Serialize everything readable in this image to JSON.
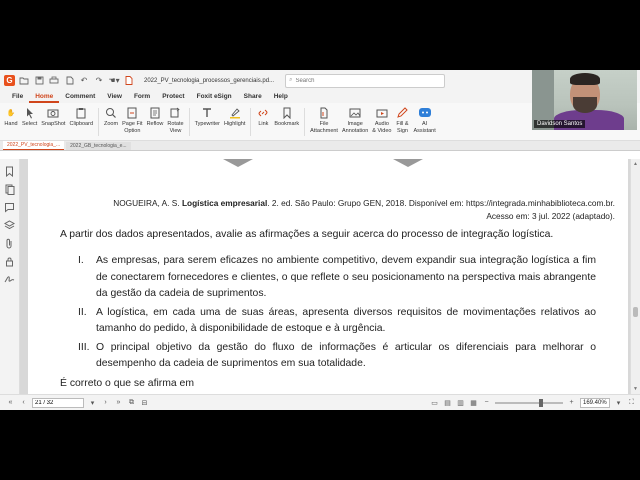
{
  "titlebar": {
    "doc_title": "2022_PV_tecnologia_processos_gerenciais.pd...",
    "search_placeholder": "Search"
  },
  "menu": {
    "items": [
      "File",
      "Home",
      "Comment",
      "View",
      "Form",
      "Protect",
      "Foxit eSign",
      "Share",
      "Help"
    ],
    "active": "Home"
  },
  "ribbon": {
    "hand": "Hand",
    "select": "Select",
    "snapshot": "SnapShot",
    "clipboard": "Clipboard",
    "zoom": "Zoom",
    "page_fit": "Page Fit\nOption",
    "reflow": "Reflow",
    "rotate": "Rotate\nView",
    "typewriter": "Typewriter",
    "highlight": "Highlight",
    "link": "Link",
    "bookmark": "Bookmark",
    "file_attachment": "File\nAttachment",
    "image_annotation": "Image\nAnnotation",
    "audio_video": "Audio\n& Video",
    "fill_sign": "Fill &\nSign",
    "ai_assistant": "AI\nAssistant"
  },
  "tabs": [
    "2022_PV_tecnologia_...",
    "2022_GB_tecnologia_e..."
  ],
  "document": {
    "ref_author": "NOGUEIRA, A. S.",
    "ref_title": "Logística empresarial",
    "ref_rest": ". 2. ed. São Paulo: Grupo GEN, 2018. Disponível em: https://integrada.minhabiblioteca.com.br.",
    "ref_access": "Acesso em: 3 jul. 2022 (adaptado).",
    "stem": "A partir dos dados apresentados, avalie as afirmações a seguir acerca do processo de integração logística.",
    "items": [
      {
        "num": "I.",
        "text": "As empresas, para serem eficazes no ambiente competitivo, devem expandir sua integração logística a fim de conectarem fornecedores e clientes, o que reflete o seu posicionamento na perspectiva mais abrangente da gestão da cadeia de suprimentos."
      },
      {
        "num": "II.",
        "text": "A logística, em cada uma de suas áreas, apresenta diversos requisitos de movimentações relativos ao tamanho do pedido, à disponibilidade de estoque e à urgência."
      },
      {
        "num": "III.",
        "text": "O principal objetivo da gestão do fluxo de informações é articular os diferenciais para melhorar o desempenho da cadeia de suprimentos em sua totalidade."
      }
    ],
    "closing": "É correto o que se afirma em"
  },
  "status": {
    "page": "21 / 32",
    "zoom": "169.40%",
    "zoom_fraction": 0.69
  },
  "webcam": {
    "name": "Davidson Santos"
  },
  "colors": {
    "accent": "#d0451b",
    "ai_blue": "#2f7fd8"
  }
}
